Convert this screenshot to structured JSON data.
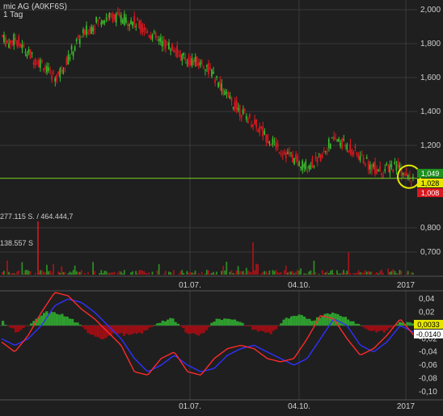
{
  "chart_data": [
    {
      "type": "candlestick",
      "title": "mic AG (A0KF6S)",
      "subtitle": "1 Tag",
      "ylim": [
        0.7,
        2.0
      ],
      "y_ticks": [
        "2,000",
        "1,800",
        "1,600",
        "1,400",
        "1,200",
        "0,800",
        "0,700"
      ],
      "x_ticks": [
        "01.07.",
        "04.10.",
        "2017"
      ],
      "grid": true,
      "horizontal_line": 1.006,
      "price_badges": [
        {
          "label": "1,049",
          "color": "#1f8f1f"
        },
        {
          "label": "1,028",
          "color": "#e6e600"
        },
        {
          "label": "1,008",
          "color": "#d9181f"
        }
      ],
      "volume": {
        "labels": [
          "277.115 S. / 464.444,7",
          "138.557 S"
        ]
      },
      "series": [
        {
          "values": [
            1.85,
            1.8,
            1.83,
            1.78,
            1.74,
            1.7,
            1.68,
            1.62,
            1.6,
            1.67,
            1.74,
            1.82,
            1.86,
            1.9,
            1.94,
            1.95,
            1.96,
            1.95,
            1.94,
            1.93,
            1.9,
            1.87,
            1.84,
            1.81,
            1.79,
            1.76,
            1.72,
            1.7,
            1.69,
            1.68,
            1.64,
            1.58,
            1.52,
            1.46,
            1.42,
            1.38,
            1.34,
            1.3,
            1.26,
            1.22,
            1.18,
            1.15,
            1.12,
            1.09,
            1.08,
            1.1,
            1.14,
            1.2,
            1.24,
            1.21,
            1.19,
            1.15,
            1.12,
            1.08,
            1.06,
            1.05,
            1.07,
            1.09,
            1.02,
            0.99
          ]
        }
      ]
    },
    {
      "type": "line",
      "y_ticks": [
        "0,04",
        "0,02",
        "-0,02",
        "-0,04",
        "-0,06",
        "-0,08",
        "-0,10"
      ],
      "x_ticks": [
        "01.07.",
        "04.10.",
        "2017"
      ],
      "ylim": [
        -0.11,
        0.05
      ],
      "value_badges": [
        {
          "label": "0,0033",
          "color": "#e6e600"
        },
        {
          "label": "-0,0140",
          "color": "#ffffff"
        }
      ],
      "series": [
        {
          "color": "#3030ff",
          "values": [
            -0.02,
            -0.03,
            -0.02,
            0.0,
            0.03,
            0.04,
            0.035,
            0.02,
            0.0,
            -0.02,
            -0.05,
            -0.07,
            -0.06,
            -0.045,
            -0.06,
            -0.07,
            -0.065,
            -0.045,
            -0.035,
            -0.03,
            -0.04,
            -0.05,
            -0.06,
            -0.05,
            -0.02,
            0.01,
            0.0,
            -0.03,
            -0.04,
            -0.025,
            0.0,
            -0.01
          ]
        },
        {
          "color": "#ff2a2a",
          "values": [
            -0.025,
            -0.04,
            -0.015,
            0.02,
            0.05,
            0.045,
            0.025,
            0.01,
            -0.01,
            -0.03,
            -0.07,
            -0.075,
            -0.05,
            -0.04,
            -0.07,
            -0.075,
            -0.05,
            -0.035,
            -0.03,
            -0.035,
            -0.05,
            -0.055,
            -0.05,
            -0.02,
            0.015,
            0.01,
            -0.02,
            -0.045,
            -0.035,
            -0.015,
            0.01,
            -0.014
          ]
        },
        {
          "color": "#2e9e2e",
          "values": [
            0.005,
            -0.01,
            0.002,
            0.02,
            0.018,
            0.008,
            -0.01,
            -0.02,
            -0.012,
            -0.015,
            -0.01,
            0.005,
            0.01,
            -0.01,
            -0.015,
            0.008,
            0.012,
            0.002,
            -0.008,
            -0.012,
            0.01,
            0.015,
            0.008,
            0.02,
            0.015,
            0.004,
            -0.008,
            -0.01,
            0.004,
            0.003
          ]
        }
      ]
    }
  ]
}
